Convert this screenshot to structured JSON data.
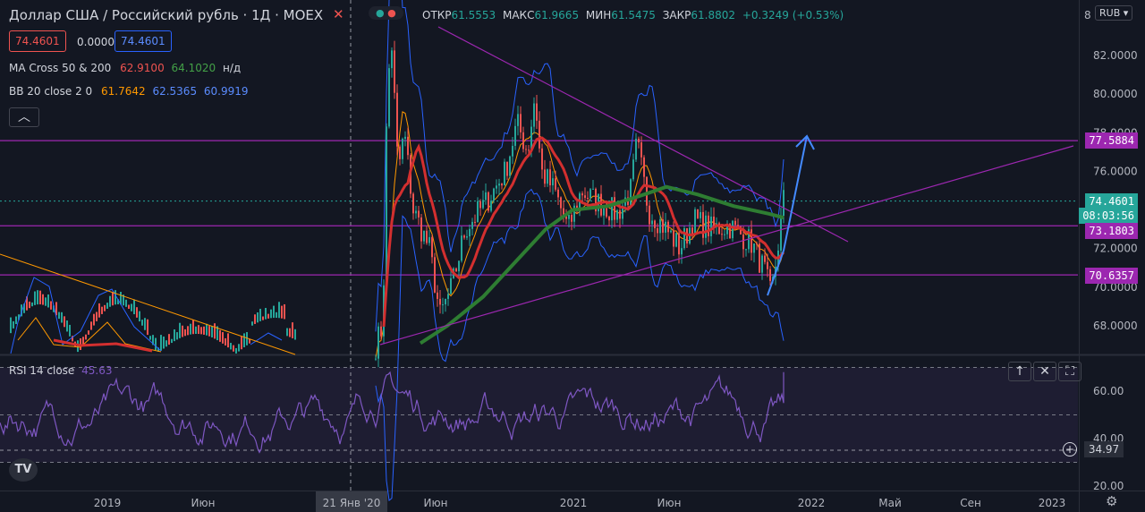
{
  "header": {
    "symbol_title": "Доллар США / Российский рубль · 1Д · MOEX",
    "ohlc": {
      "open_label": "ОТКР",
      "open_value": "61.5553",
      "high_label": "МАКС",
      "high_value": "61.9665",
      "low_label": "МИН",
      "low_value": "61.5475",
      "close_label": "ЗАКР",
      "close_value": "61.8802",
      "change": "+0.3249 (+0.53%)"
    },
    "bid_value": "74.4601",
    "spread_value": "0.0000",
    "ask_value": "74.4601",
    "currency": "RUB"
  },
  "indicators": {
    "ma_cross": {
      "label": "MA Cross 50 & 200",
      "v1": "62.9100",
      "v2": "64.1020",
      "v3": "н/д"
    },
    "bb": {
      "label": "BB 20 close 2 0",
      "v1": "61.7642",
      "v2": "62.5365",
      "v3": "60.9919"
    },
    "rsi": {
      "label": "RSI 14 close",
      "value": "45.63"
    }
  },
  "price_axis": {
    "top_partial": "8",
    "ticks": [
      "82.0000",
      "80.0000",
      "78.0000",
      "76.0000",
      "74.0000",
      "72.0000",
      "70.0000",
      "68.0000"
    ],
    "tags": {
      "level_77": "77.5884",
      "current": "74.4601",
      "countdown": "08:03:56",
      "level_73": "73.1803",
      "level_70": "70.6357"
    }
  },
  "rsi_axis": {
    "ticks": [
      "60.00",
      "40.00",
      "20.00"
    ],
    "crosshair_value": "34.97"
  },
  "time_axis": {
    "labels": [
      "2019",
      "Июн",
      "21 Янв '20",
      "Июн",
      "2021",
      "Июн",
      "2022",
      "Май",
      "Сен",
      "2023"
    ]
  },
  "colors": {
    "background": "#131722",
    "candle_up": "#26a69a",
    "candle_down": "#ef5350",
    "ma50": "#d32f2f",
    "ma200": "#2e7d32",
    "bb_basis": "#ff9800",
    "bb_band": "#2962ff",
    "rsi_line": "#7e57c2",
    "level_line": "#9c27b0"
  },
  "chart_data": {
    "type": "line",
    "title": "Доллар США / Российский рубль · 1Д · MOEX",
    "xlabel": "",
    "ylabel": "",
    "x": [
      "2019-01",
      "2019-03",
      "2019-05",
      "2019-07",
      "2019-09",
      "2019-11",
      "2020-01",
      "2020-02",
      "2020-03",
      "2020-04",
      "2020-05",
      "2020-06",
      "2020-07",
      "2020-08",
      "2020-09",
      "2020-10",
      "2020-11",
      "2020-12",
      "2021-01",
      "2021-02",
      "2021-03",
      "2021-04",
      "2021-05",
      "2021-06",
      "2021-07",
      "2021-08",
      "2021-09",
      "2021-10",
      "2021-11",
      "2021-12"
    ],
    "series": [
      {
        "name": "USD/RUB",
        "values": [
          67.0,
          66.0,
          65.0,
          64.0,
          64.5,
          63.8,
          61.9,
          66.0,
          78.0,
          74.0,
          71.0,
          69.3,
          71.5,
          73.8,
          76.5,
          77.5,
          76.5,
          74.0,
          74.5,
          74.0,
          75.5,
          76.0,
          73.5,
          72.5,
          73.5,
          73.0,
          72.5,
          71.0,
          72.5,
          74.46
        ]
      }
    ],
    "horizontal_levels": [
      77.5884,
      73.1803,
      70.6357
    ],
    "ylim": [
      67.0,
      83.0
    ],
    "rsi": {
      "label": "RSI 14 close",
      "last": 45.63,
      "ylim": [
        20,
        70
      ]
    }
  }
}
